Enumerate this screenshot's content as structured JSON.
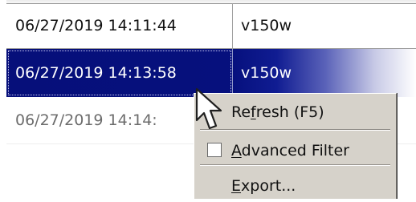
{
  "table": {
    "rows": [
      {
        "date": "06/27/2019 14:11:44",
        "user": "v150w",
        "selected": false
      },
      {
        "date": "06/27/2019 14:13:58",
        "user": "v150w",
        "selected": true
      },
      {
        "date": "06/27/2019 14:14:",
        "user": "",
        "selected": false
      }
    ]
  },
  "context_menu": {
    "refresh": {
      "pre": "Re",
      "mnemonic": "f",
      "post": "resh (F5)"
    },
    "advanced_filter": {
      "pre": "",
      "mnemonic": "A",
      "post": "dvanced Filter",
      "checked": false
    },
    "export": {
      "pre": "",
      "mnemonic": "E",
      "post": "xport..."
    }
  },
  "colors": {
    "selection": "#06107d",
    "menu_background": "#d6d2ca",
    "text": "#111111",
    "selected_text": "#ffffff"
  },
  "icons": {
    "cursor": "mouse-pointer-icon",
    "checkbox": "checkbox-icon"
  }
}
